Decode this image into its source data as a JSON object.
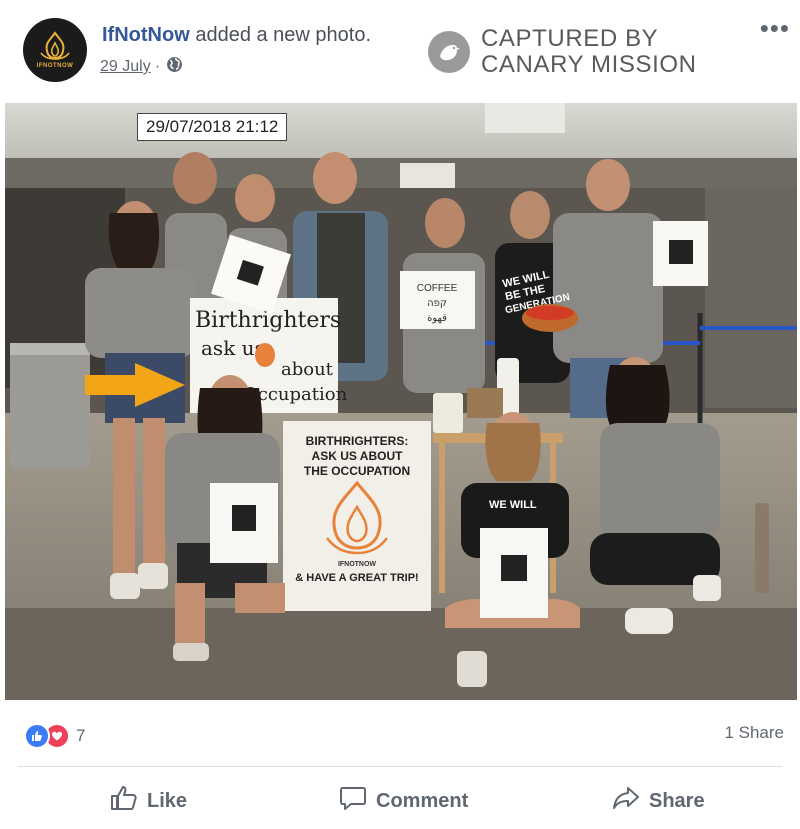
{
  "post": {
    "page_name": "IfNotNow",
    "action_text": "added a new photo.",
    "date": "29 July",
    "separator": "·",
    "more": "•••",
    "avatar_text": "IFNOTNOW"
  },
  "watermark": {
    "line1": "CAPTURED BY",
    "line2": "CANARY MISSION"
  },
  "photo": {
    "timestamp": "29/07/2018 21:12",
    "signs": {
      "left_sign_line1": "Birthrighters",
      "left_sign_line2": "ask us",
      "left_sign_line3": "about",
      "left_sign_line4": "Occupation",
      "center_sign_line1": "BIRTHRIGHTERS:",
      "center_sign_line2": "ASK US ABOUT",
      "center_sign_line3": "THE OCCUPATION",
      "center_sign_brand": "IFNOTNOW",
      "center_sign_line4": "& HAVE A GREAT TRIP!",
      "coffee_sign_line1": "COFFEE",
      "coffee_sign_line2": "קפה",
      "coffee_sign_line3": "قهوة",
      "shirt_line1": "WE WILL",
      "shirt_line2": "BE THE",
      "shirt_line3": "GENERATION",
      "shirt_front": "WE WILL"
    },
    "colors": {
      "brand_orange": "#e8823a",
      "arrow": "#f2a516"
    }
  },
  "stats": {
    "reaction_count": "7",
    "shares": "1 Share"
  },
  "actions": {
    "like": "Like",
    "comment": "Comment",
    "share": "Share"
  },
  "colors": {
    "link_blue": "#365899",
    "like_blue": "#3b7bf6",
    "love_red": "#f0405a"
  }
}
